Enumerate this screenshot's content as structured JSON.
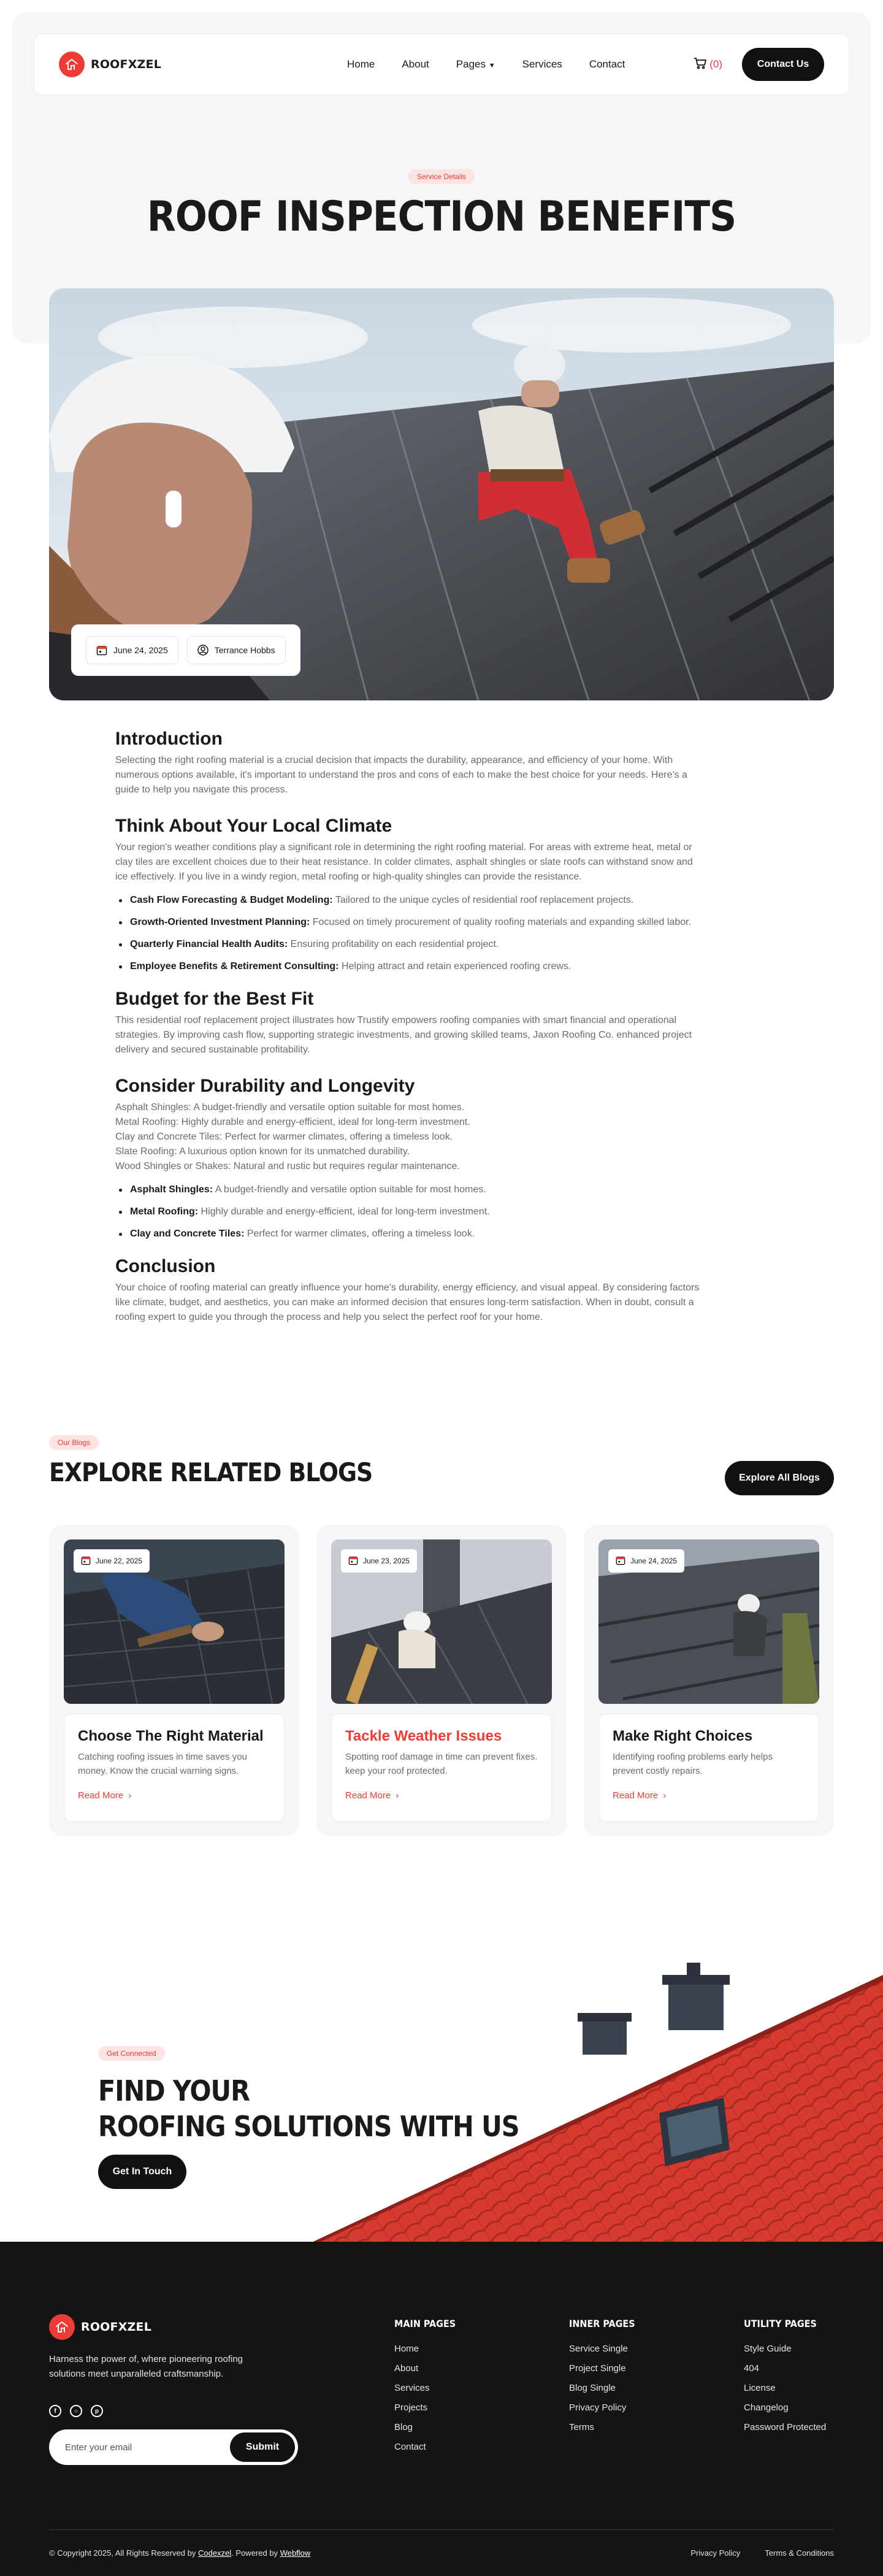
{
  "brand": {
    "name": "ROOFXZEL",
    "accent": "#ef3b36",
    "dark": "#111111"
  },
  "nav": {
    "links": [
      "Home",
      "About",
      "Pages",
      "Services",
      "Contact"
    ],
    "cart_count": "(0)",
    "contact_label": "Contact Us"
  },
  "hero": {
    "pill": "Service Details",
    "title": "ROOF INSPECTION BENEFITS",
    "date": "June 24, 2025",
    "author": "Terrance Hobbs"
  },
  "article": {
    "intro_title": "Introduction",
    "intro_text": "Selecting the right roofing material is a crucial decision that impacts the durability, appearance, and efficiency of your home. With numerous options available, it's important to understand the pros and cons of each to make the best choice for your needs. Here's a guide to help you navigate this process.",
    "climate_title": "Think About Your Local Climate",
    "climate_text": "Your region's weather conditions play a significant role in determining the right roofing material. For areas with extreme heat, metal or clay tiles are excellent choices due to their heat resistance. In colder climates, asphalt shingles or slate roofs can withstand snow and ice effectively. If you live in a windy region, metal roofing or high-quality shingles can provide the resistance.",
    "climate_list": [
      {
        "term": "Cash Flow Forecasting & Budget Modeling:",
        "desc": " Tailored to the unique cycles of residential roof replacement projects."
      },
      {
        "term": "Growth-Oriented Investment Planning:",
        "desc": " Focused on timely procurement of quality roofing materials and expanding skilled labor."
      },
      {
        "term": "Quarterly Financial Health Audits:",
        "desc": " Ensuring profitability on each residential project."
      },
      {
        "term": "Employee Benefits & Retirement Consulting:",
        "desc": " Helping attract and retain experienced roofing crews."
      }
    ],
    "budget_title": "Budget for the Best Fit",
    "budget_text": "This residential roof replacement project illustrates how Trustify empowers roofing companies with smart financial and operational strategies. By improving cash flow, supporting strategic investments, and growing skilled teams, Jaxon Roofing Co. enhanced project delivery and secured sustainable profitability.",
    "durability_title": "Consider Durability and Longevity",
    "durability_lines": [
      "Asphalt Shingles: A budget-friendly and versatile option suitable for most homes.",
      "Metal Roofing: Highly durable and energy-efficient, ideal for long-term investment.",
      "Clay and Concrete Tiles: Perfect for warmer climates, offering a timeless look.",
      "Slate Roofing: A luxurious option known for its unmatched durability.",
      "Wood Shingles or Shakes: Natural and rustic but requires regular maintenance."
    ],
    "durability_list": [
      {
        "term": "Asphalt Shingles:",
        "desc": " A budget-friendly and versatile option suitable for most homes."
      },
      {
        "term": "Metal Roofing:",
        "desc": " Highly durable and energy-efficient, ideal for long-term investment."
      },
      {
        "term": "Clay and Concrete Tiles:",
        "desc": " Perfect for warmer climates, offering a timeless look."
      }
    ],
    "conclusion_title": "Conclusion",
    "conclusion_text": "Your choice of roofing material can greatly influence your home's durability, energy efficiency, and visual appeal. By considering factors like climate, budget, and aesthetics, you can make an informed decision that ensures long-term satisfaction. When in doubt, consult a roofing expert to guide you through the process and help you select the perfect roof for your home."
  },
  "blogs": {
    "pill": "Our Blogs",
    "title": "EXPLORE RELATED BLOGS",
    "explore_label": "Explore All Blogs",
    "items": [
      {
        "date": "June 22, 2025",
        "title": "Choose The Right Material",
        "text": "Catching roofing issues in time saves you money. Know the crucial warning signs.",
        "link": "Read More"
      },
      {
        "date": "June 23, 2025",
        "title": "Tackle Weather Issues",
        "text": "Spotting roof damage in time can prevent fixes. keep your roof protected.",
        "link": "Read More"
      },
      {
        "date": "June 24, 2025",
        "title": "Make Right Choices",
        "text": "Identifying roofing problems early helps prevent costly repairs.",
        "link": "Read More"
      }
    ]
  },
  "cta": {
    "pill": "Get Connected",
    "title_line1": "FIND YOUR",
    "title_line2": "ROOFING SOLUTIONS WITH US",
    "button": "Get In Touch"
  },
  "footer": {
    "description": "Harness the power of, where pioneering roofing solutions meet unparalleled craftsmanship.",
    "email_placeholder": "Enter your email",
    "submit": "Submit",
    "columns": [
      {
        "title": "MAIN PAGES",
        "links": [
          "Home",
          "About",
          "Services",
          "Projects",
          "Blog",
          "Contact"
        ]
      },
      {
        "title": "INNER PAGES",
        "links": [
          "Service Single",
          "Project Single",
          "Blog Single",
          "Privacy Policy",
          "Terms"
        ]
      },
      {
        "title": "UTILITY PAGES",
        "links": [
          "Style Guide",
          "404",
          "License",
          "Changelog",
          "Password Protected"
        ]
      }
    ],
    "copyright_prefix": "© Copyright 2025, All Rights Reserved by ",
    "copyright_brand": "Codexzel",
    "copyright_mid": ". Powered by ",
    "copyright_platform": "Webflow",
    "legal": [
      "Privacy Policy",
      "Terms & Conditions"
    ]
  }
}
